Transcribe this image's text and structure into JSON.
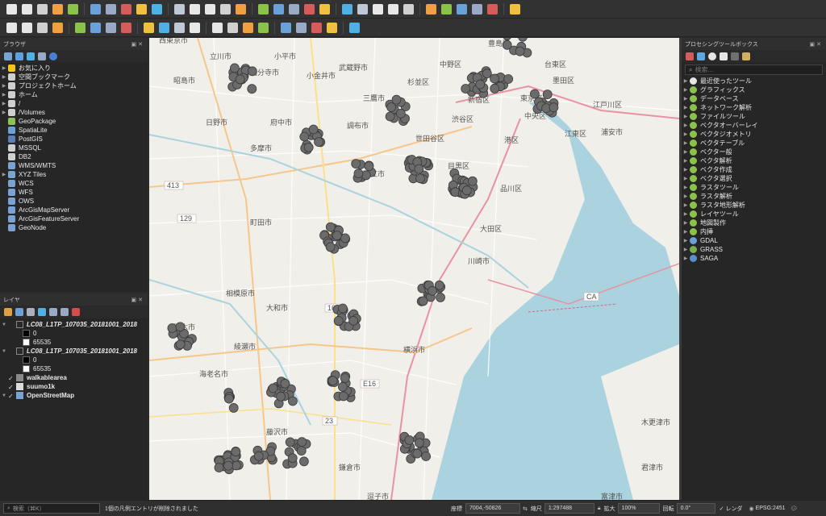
{
  "toolbar_top": {
    "icons": [
      "new-project-icon",
      "open-project-icon",
      "save-project-icon",
      "save-as-icon",
      "print-layout-icon",
      "layout-manager-icon",
      "style-manager-icon",
      "pan-icon",
      "pan-to-selection-icon",
      "zoom-in-icon",
      "zoom-out-icon",
      "zoom-full-icon",
      "zoom-selection-icon",
      "zoom-layer-icon",
      "zoom-native-icon",
      "zoom-last-icon",
      "zoom-next-icon",
      "bookmark-new-icon",
      "bookmark-show-icon",
      "refresh-icon",
      "identify-icon",
      "measure-icon",
      "select-features-icon",
      "deselect-icon",
      "attribute-table-icon",
      "field-calc-icon",
      "gear-icon",
      "sum-icon",
      "ruler-icon",
      "tooltip-icon",
      "text-annotation-icon"
    ]
  },
  "toolbar_second": {
    "icons": [
      "digitize-icon",
      "edit-pencil-icon",
      "save-edits-icon",
      "add-feature-icon",
      "move-feature-icon",
      "vertex-tool-icon",
      "delete-selected-icon",
      "cut-icon",
      "copy-icon",
      "paste-icon",
      "undo-icon",
      "redo-icon",
      "label-icon",
      "label-pin-icon",
      "label-show-icon",
      "label-move-icon",
      "label-rotate-icon",
      "label-change-icon",
      "python-icon",
      "help-icon",
      "plugin-icon"
    ]
  },
  "browser_panel": {
    "title": "ブラウザ",
    "items": [
      {
        "label": "お気に入り",
        "icon": "star-icon",
        "color": "#f5c518",
        "expand": true
      },
      {
        "label": "空間ブックマーク",
        "icon": "bookmark-folder-icon",
        "color": "#cfcfcf",
        "expand": true
      },
      {
        "label": "プロジェクトホーム",
        "icon": "folder-icon",
        "color": "#cfcfcf",
        "expand": true
      },
      {
        "label": "ホーム",
        "icon": "folder-icon",
        "color": "#cfcfcf",
        "expand": true
      },
      {
        "label": "/",
        "icon": "folder-icon",
        "color": "#cfcfcf",
        "expand": true
      },
      {
        "label": "/Volumes",
        "icon": "folder-icon",
        "color": "#cfcfcf",
        "expand": true
      },
      {
        "label": "GeoPackage",
        "icon": "geopackage-icon",
        "color": "#8fc15a",
        "expand": false
      },
      {
        "label": "SpatiaLite",
        "icon": "spatialite-icon",
        "color": "#6aa1d8",
        "expand": false
      },
      {
        "label": "PostGIS",
        "icon": "postgis-icon",
        "color": "#5c7fb5",
        "expand": false
      },
      {
        "label": "MSSQL",
        "icon": "mssql-icon",
        "color": "#d0d0d0",
        "expand": false
      },
      {
        "label": "DB2",
        "icon": "db2-icon",
        "color": "#d0d0d0",
        "expand": false
      },
      {
        "label": "WMS/WMTS",
        "icon": "wms-icon",
        "color": "#7aa3d4",
        "expand": false
      },
      {
        "label": "XYZ Tiles",
        "icon": "xyz-tiles-icon",
        "color": "#7aa3d4",
        "expand": true
      },
      {
        "label": "WCS",
        "icon": "wcs-icon",
        "color": "#7aa3d4",
        "expand": false
      },
      {
        "label": "WFS",
        "icon": "wfs-icon",
        "color": "#7aa3d4",
        "expand": false
      },
      {
        "label": "OWS",
        "icon": "ows-icon",
        "color": "#7aa3d4",
        "expand": false
      },
      {
        "label": "ArcGisMapServer",
        "icon": "arcgis-icon",
        "color": "#7aa3d4",
        "expand": false
      },
      {
        "label": "ArcGisFeatureServer",
        "icon": "arcgis-icon",
        "color": "#7aa3d4",
        "expand": false
      },
      {
        "label": "GeoNode",
        "icon": "geonode-icon",
        "color": "#7aa3d4",
        "expand": false
      }
    ]
  },
  "layers_panel": {
    "title": "レイヤ",
    "layers": [
      {
        "label": "LC08_L1TP_107035_20181001_2018",
        "checked": false,
        "expand": true,
        "italic": true,
        "legend": [
          {
            "label": "0",
            "swatch": "#000000"
          },
          {
            "label": "65535",
            "swatch": "#ffffff"
          }
        ]
      },
      {
        "label": "LC08_L1TP_107035_20181001_2018",
        "checked": false,
        "expand": true,
        "italic": true,
        "legend": [
          {
            "label": "0",
            "swatch": "#000000"
          },
          {
            "label": "65535",
            "swatch": "#ffffff"
          }
        ]
      },
      {
        "label": "walkablearea",
        "checked": true,
        "expand": false,
        "italic": false,
        "swatch": "#8a8a8a",
        "legend": []
      },
      {
        "label": "suumo1k",
        "checked": true,
        "expand": false,
        "italic": false,
        "swatch": "#dcdcdc",
        "legend": []
      },
      {
        "label": "OpenStreetMap",
        "checked": true,
        "expand": true,
        "italic": false,
        "swatch": "#7aa3d4",
        "legend": []
      }
    ]
  },
  "processing_panel": {
    "title": "プロセシングツールボックス",
    "search_placeholder": "検索...",
    "items": [
      {
        "label": "最近使ったツール",
        "icon": "clock-icon",
        "color": "#e6e6e6"
      },
      {
        "label": "グラフィックス",
        "icon": "qgis-q-icon",
        "color": "#8bc34a"
      },
      {
        "label": "データベース",
        "icon": "qgis-q-icon",
        "color": "#8bc34a"
      },
      {
        "label": "ネットワーク解析",
        "icon": "qgis-q-icon",
        "color": "#8bc34a"
      },
      {
        "label": "ファイルツール",
        "icon": "qgis-q-icon",
        "color": "#8bc34a"
      },
      {
        "label": "ベクタオーバーレイ",
        "icon": "qgis-q-icon",
        "color": "#8bc34a"
      },
      {
        "label": "ベクタジオメトリ",
        "icon": "qgis-q-icon",
        "color": "#8bc34a"
      },
      {
        "label": "ベクタテーブル",
        "icon": "qgis-q-icon",
        "color": "#8bc34a"
      },
      {
        "label": "ベクター般",
        "icon": "qgis-q-icon",
        "color": "#8bc34a"
      },
      {
        "label": "ベクタ解析",
        "icon": "qgis-q-icon",
        "color": "#8bc34a"
      },
      {
        "label": "ベクタ作成",
        "icon": "qgis-q-icon",
        "color": "#8bc34a"
      },
      {
        "label": "ベクタ選択",
        "icon": "qgis-q-icon",
        "color": "#8bc34a"
      },
      {
        "label": "ラスタツール",
        "icon": "qgis-q-icon",
        "color": "#8bc34a"
      },
      {
        "label": "ラスタ解析",
        "icon": "qgis-q-icon",
        "color": "#8bc34a"
      },
      {
        "label": "ラスタ地形解析",
        "icon": "qgis-q-icon",
        "color": "#8bc34a"
      },
      {
        "label": "レイヤツール",
        "icon": "qgis-q-icon",
        "color": "#8bc34a"
      },
      {
        "label": "地図製作",
        "icon": "qgis-q-icon",
        "color": "#8bc34a"
      },
      {
        "label": "内挿",
        "icon": "qgis-q-icon",
        "color": "#8bc34a"
      },
      {
        "label": "GDAL",
        "icon": "gdal-icon",
        "color": "#6aa1d8"
      },
      {
        "label": "GRASS",
        "icon": "grass-icon",
        "color": "#7ab04a"
      },
      {
        "label": "SAGA",
        "icon": "saga-icon",
        "color": "#5b8fd0"
      }
    ]
  },
  "map": {
    "labels": [
      "西東京市",
      "立川市",
      "小平市",
      "昭島市",
      "国分寺市",
      "小金井市",
      "武蔵野市",
      "中野区",
      "豊島区",
      "台東区",
      "墨田区",
      "杉並区",
      "新宿区",
      "三鷹市",
      "東京都",
      "江戸川区",
      "日野市",
      "府中市",
      "調布市",
      "渋谷区",
      "中央区",
      "浦安市",
      "多摩市",
      "狛江市",
      "世田谷区",
      "港区",
      "江東区",
      "目黒区",
      "品川区",
      "町田市",
      "大田区",
      "川崎市",
      "相模原市",
      "大和市",
      "厚木市",
      "綾瀬市",
      "横浜市",
      "海老名市",
      "藤沢市",
      "鎌倉市",
      "逗子市",
      "木更津市",
      "君津市",
      "富津市"
    ],
    "road_labels": [
      "413",
      "129",
      "16",
      "E16",
      "CA",
      "23"
    ]
  },
  "statusbar": {
    "search_placeholder": "検索（⌘K）",
    "message": "1個の凡例エントリが削除されました",
    "coord_label": "座標",
    "coord_value": "7004,-50826",
    "scale_label": "縮尺",
    "scale_value": "1:297488",
    "magnifier_label": "拡大",
    "magnifier_value": "100%",
    "rotation_label": "回転",
    "rotation_value": "0.0°",
    "render_label": "レンダ",
    "crs_label": "EPSG:2451"
  }
}
